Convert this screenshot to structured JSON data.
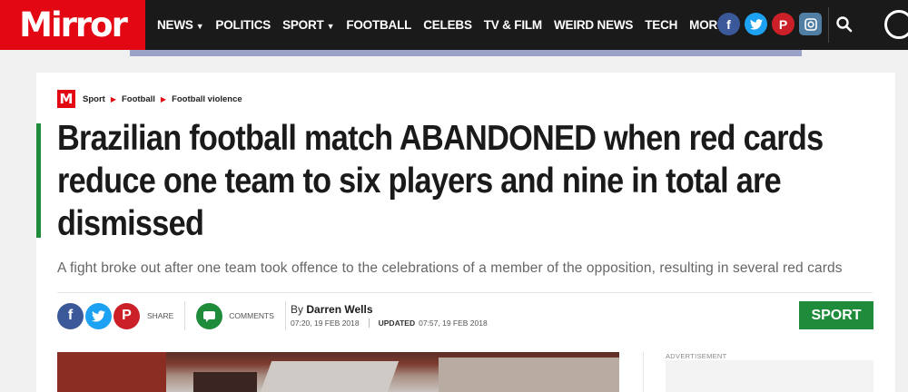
{
  "header": {
    "logo": "Mirror",
    "nav": [
      {
        "label": "NEWS",
        "dropdown": true
      },
      {
        "label": "POLITICS",
        "dropdown": false
      },
      {
        "label": "SPORT",
        "dropdown": true
      },
      {
        "label": "FOOTBALL",
        "dropdown": false
      },
      {
        "label": "CELEBS",
        "dropdown": false
      },
      {
        "label": "TV & FILM",
        "dropdown": false
      },
      {
        "label": "WEIRD NEWS",
        "dropdown": false
      },
      {
        "label": "TECH",
        "dropdown": false
      },
      {
        "label": "MORE",
        "dropdown": true
      }
    ],
    "social_icons": [
      "facebook-icon",
      "twitter-icon",
      "pinterest-icon",
      "instagram-icon"
    ],
    "brand_color": "#e30613"
  },
  "breadcrumb": {
    "logo_letter": "M",
    "items": [
      "Sport",
      "Football",
      "Football violence"
    ]
  },
  "article": {
    "headline": "Brazilian football match ABANDONED when red cards reduce one team to six players and nine in total are dismissed",
    "standfirst": "A fight broke out after one team took offence to the celebrations of a member of the opposition, resulting in several red cards",
    "share_label": "SHARE",
    "comments_label": "COMMENTS",
    "byline_prefix": "By",
    "author": "Darren Wells",
    "published": "07:20, 19 FEB 2018",
    "updated_label": "UPDATED",
    "updated": "07:57, 19 FEB 2018",
    "section_badge": "SPORT",
    "section_color": "#1e8c3a"
  },
  "sidebar": {
    "ad_label": "ADVERTISEMENT"
  }
}
